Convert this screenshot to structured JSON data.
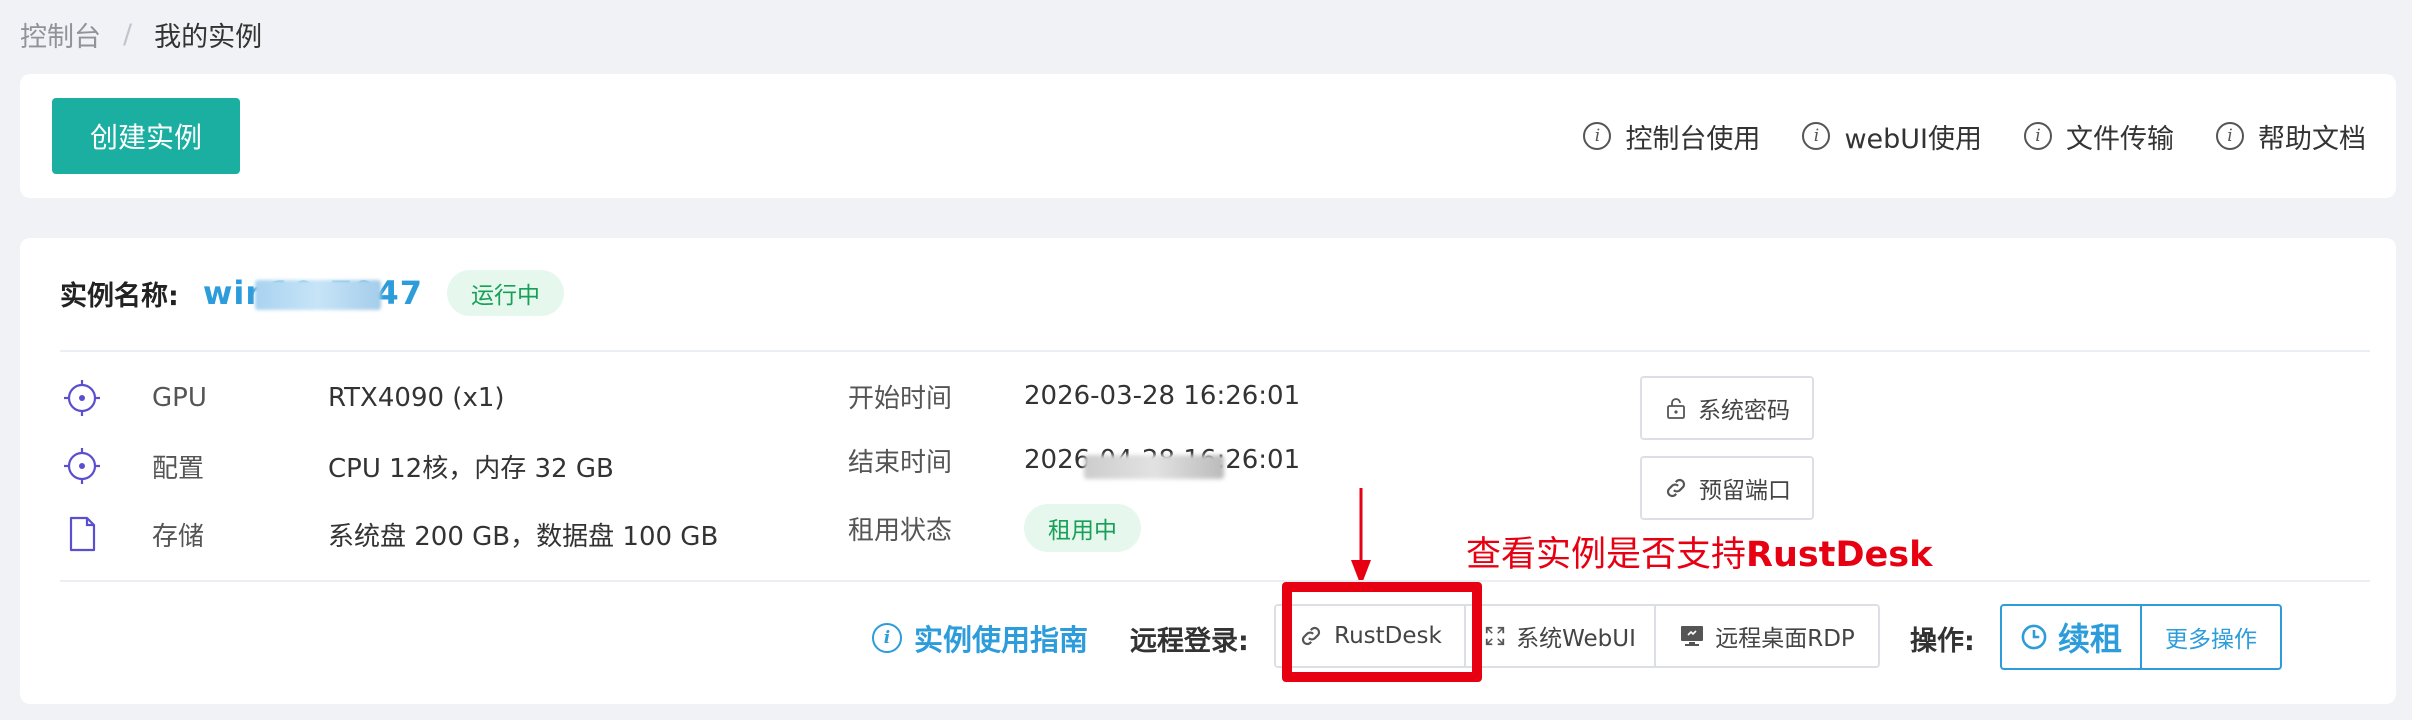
{
  "breadcrumb": {
    "root": "控制台",
    "separator": "/",
    "current": "我的实例"
  },
  "toolbar": {
    "create_label": "创建实例",
    "help_links": [
      {
        "label": "控制台使用"
      },
      {
        "label": "webUI使用"
      },
      {
        "label": "文件传输"
      },
      {
        "label": "帮助文档"
      }
    ]
  },
  "instance": {
    "name_label": "实例名称:",
    "name": "win10-7947",
    "status": "运行中",
    "specs": [
      {
        "key": "GPU",
        "value": "RTX4090 (x1)",
        "icon": "gpu-icon"
      },
      {
        "key": "配置",
        "value": "CPU 12核，内存 32 GB",
        "icon": "cpu-icon"
      },
      {
        "key": "存储",
        "value": "系统盘 200 GB，数据盘 100 GB",
        "icon": "storage-icon"
      }
    ],
    "times": {
      "start_label": "开始时间",
      "start_value": "2026-03-28 16:26:01",
      "end_label": "结束时间",
      "end_value": "2026-04-28 16:26:01",
      "rent_label": "租用状态",
      "rent_status": "租用中"
    },
    "side_buttons": {
      "password": "系统密码",
      "ports": "预留端口"
    },
    "guide_label": "实例使用指南",
    "remote_label": "远程登录:",
    "remote_buttons": {
      "rustdesk": "RustDesk",
      "webui": "系统WebUI",
      "rdp": "远程桌面RDP"
    },
    "ops_label": "操作:",
    "renew_label": "续租",
    "more_label": "更多操作"
  },
  "annotation": {
    "prefix": "查看实例是否支持",
    "highlight": "RustDesk"
  },
  "colors": {
    "accent": "#1aafa0",
    "link": "#2d9cdb",
    "success": "#18a058",
    "annotation": "#e60012"
  }
}
